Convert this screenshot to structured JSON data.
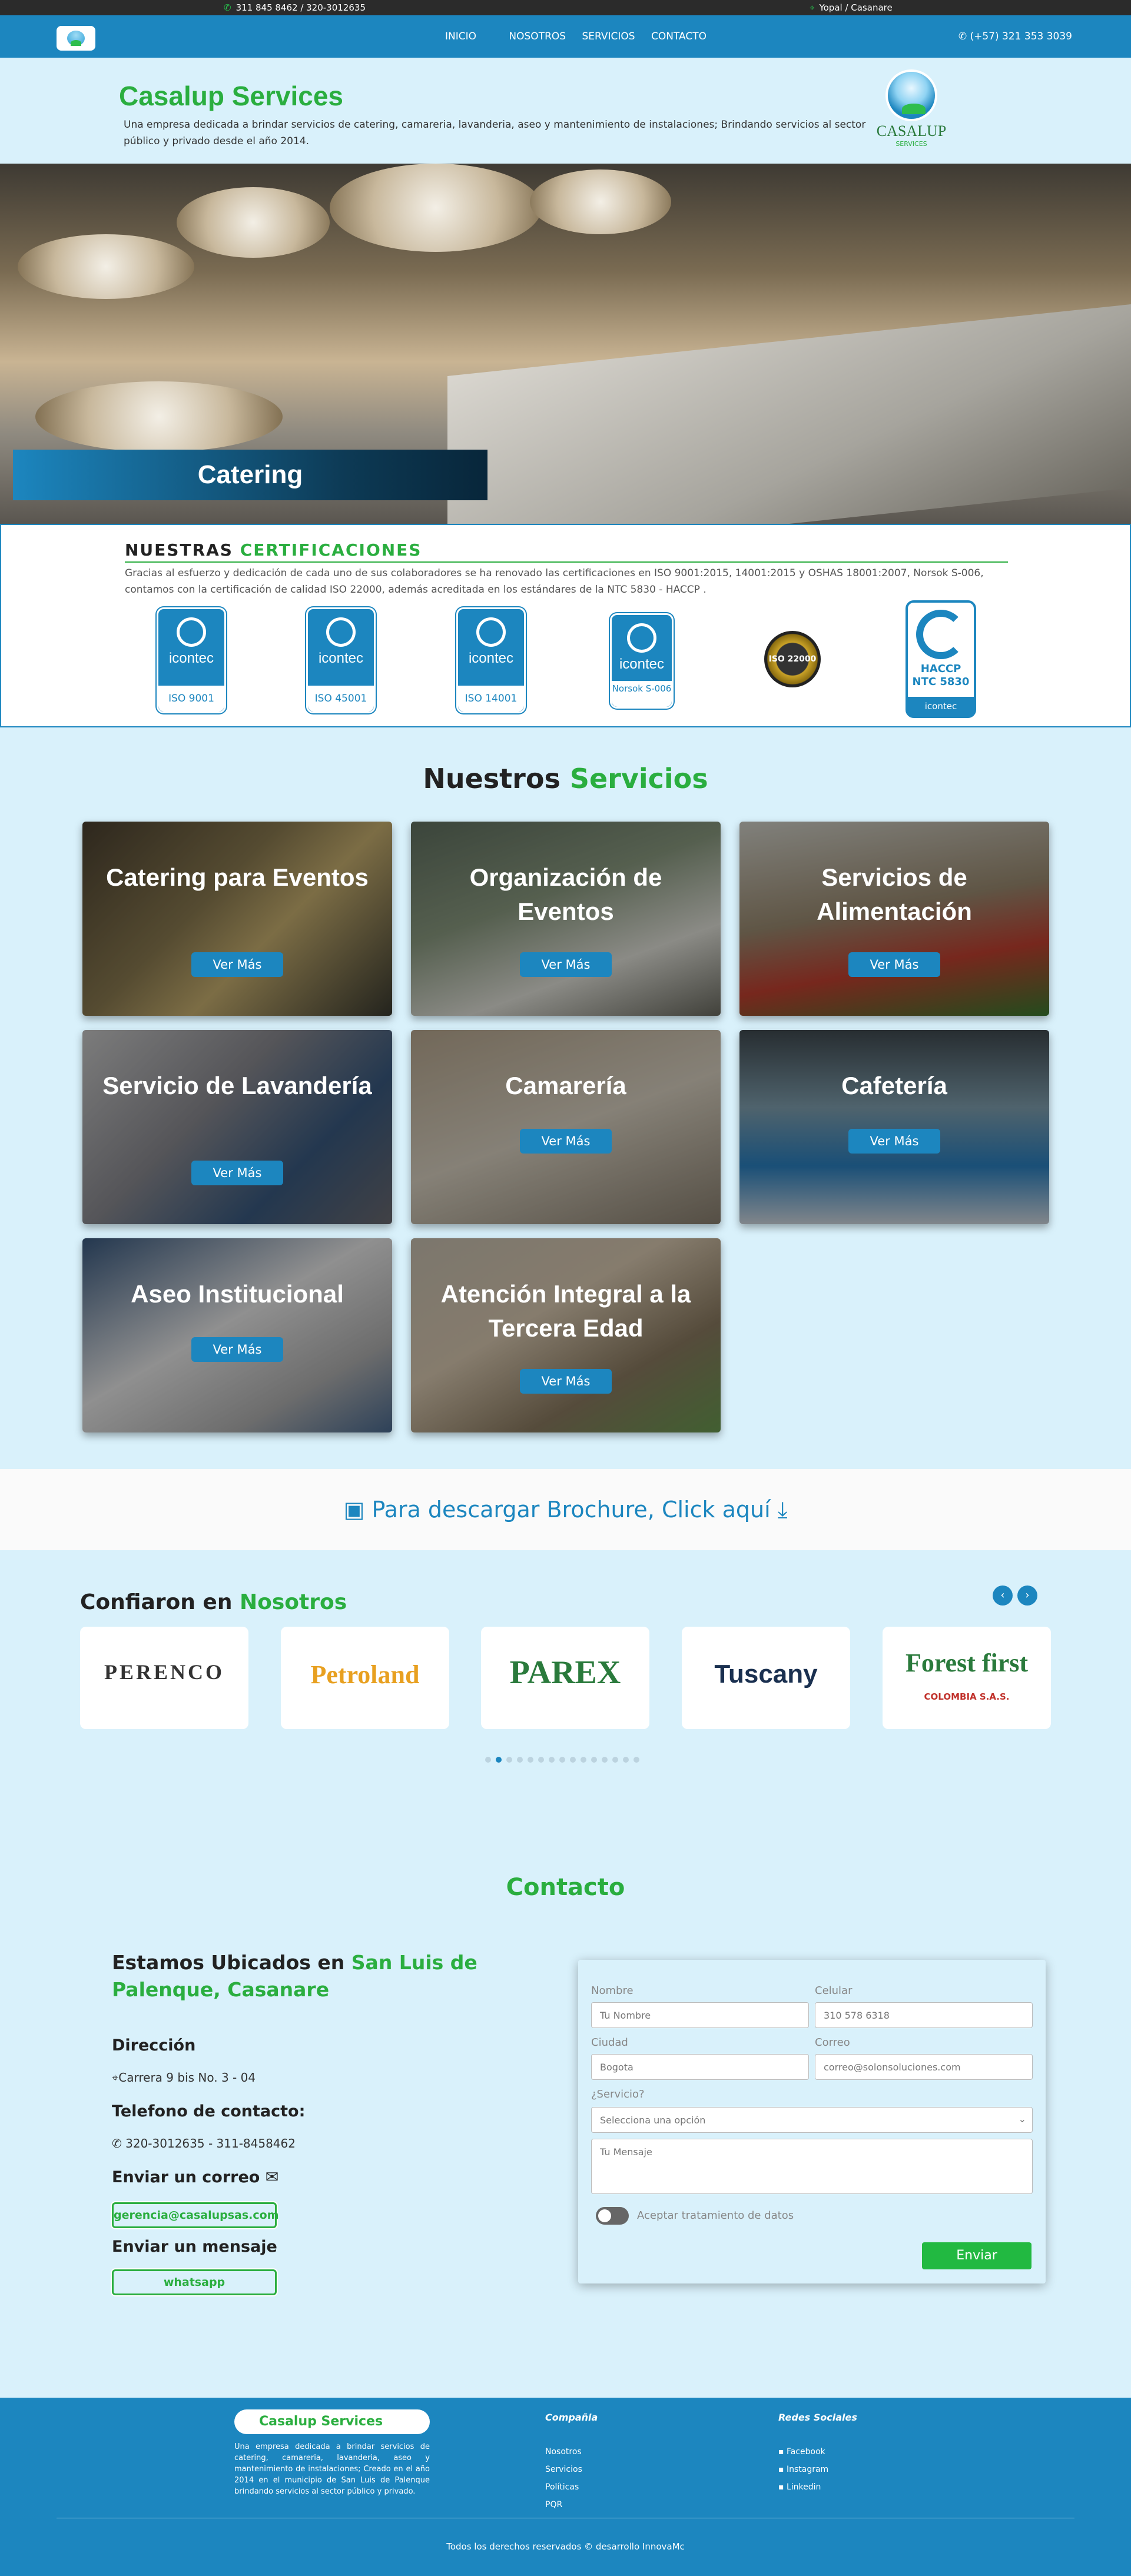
{
  "topbar": {
    "phones": "311 845 8462 / 320-3012635",
    "location": "Yopal / Casanare"
  },
  "nav": {
    "items": [
      "INICIO",
      "NOSOTROS",
      "SERVICIOS",
      "CONTACTO"
    ],
    "phone": "(+57) 321 353 3039"
  },
  "hero": {
    "title": "Casalup Services",
    "description": "Una empresa dedicada a brindar servicios de catering, camareria, lavanderia, aseo y mantenimiento de instalaciones; Brindando servicios al sector público y privado desde el año 2014.",
    "logo_name": "CASALUP",
    "logo_sub": "SERVICES",
    "banner_caption": "Catering"
  },
  "certifications": {
    "title_prefix": "NUESTRAS",
    "title_highlight": "CERTIFICACIONES",
    "text": "Gracias al esfuerzo y dedicación de cada uno de sus colaboradores se ha renovado las certificaciones en ISO 9001:2015, 14001:2015 y OSHAS 18001:2007, Norsok S-006, contamos con la certificación de calidad ISO 22000, además acreditada en los estándares de la NTC 5830 - HACCP .",
    "brand": "icontec",
    "badges": [
      "ISO 9001",
      "ISO 45001",
      "ISO 14001",
      "Norsok S-006"
    ],
    "iso22000": "ISO 22000",
    "haccp": "HACCP NTC 5830",
    "haccp_brand": "icontec"
  },
  "services": {
    "title_prefix": "Nuestros",
    "title_highlight": "Servicios",
    "button": "Ver Más",
    "items": [
      {
        "title": "Catering para Eventos"
      },
      {
        "title": "Organización de Eventos"
      },
      {
        "title": "Servicios de Alimentación"
      },
      {
        "title": "Servicio de Lavandería"
      },
      {
        "title": "Camarería"
      },
      {
        "title": "Cafetería"
      },
      {
        "title": "Aseo Institucional"
      },
      {
        "title": "Atención Integral a la Tercera Edad"
      }
    ]
  },
  "brochure": {
    "text": "Para descargar Brochure, Click aquí"
  },
  "partners": {
    "title_prefix": "Confiaron en",
    "title_highlight": "Nosotros",
    "logos": [
      "PERENCO",
      "Petroland",
      "PAREX",
      "Tuscany",
      "Forest first"
    ],
    "forest_sub": "COLOMBIA S.A.S."
  },
  "contact": {
    "title": "Contacto",
    "located_prefix": "Estamos Ubicados en",
    "located_highlight": "San Luis de Palenque, Casanare",
    "address_label": "Dirección",
    "address": "Carrera 9 bis No. 3 - 04",
    "phone_label": "Telefono de contacto:",
    "phone": "320-3012635 - 311-8458462",
    "email_label": "Enviar un correo",
    "email": "gerencia@casalupsas.com",
    "message_label": "Enviar un mensaje",
    "whatsapp": "whatsapp",
    "form": {
      "name_label": "Nombre",
      "name_placeholder": "Tu Nombre",
      "cell_label": "Celular",
      "cell_placeholder": "310 578 6318",
      "city_label": "Ciudad",
      "city_placeholder": "Bogota",
      "mail_label": "Correo",
      "mail_placeholder": "correo@solonsoluciones.com",
      "service_label": "¿Servicio?",
      "service_option": "Selecciona una opción",
      "message_placeholder": "Tu Mensaje",
      "consent": "Aceptar tratamiento de datos",
      "submit": "Enviar"
    }
  },
  "footer": {
    "brand": "Casalup Services",
    "description": "Una empresa dedicada a brindar servicios de catering, camareria, lavanderia, aseo y mantenimiento de instalaciones; Creado en el año 2014 en el municipio de San Luis de Palenque brindando servicios al sector público y privado.",
    "company_heading": "Compañia",
    "company_links": [
      "Nosotros",
      "Servicios",
      "Políticas",
      "PQR"
    ],
    "social_heading": "Redes Sociales",
    "social_links": [
      "Facebook",
      "Instagram",
      "Linkedin"
    ],
    "copyright": "Todos los derechos reservados © desarrollo",
    "dev": "InnovaMc"
  }
}
